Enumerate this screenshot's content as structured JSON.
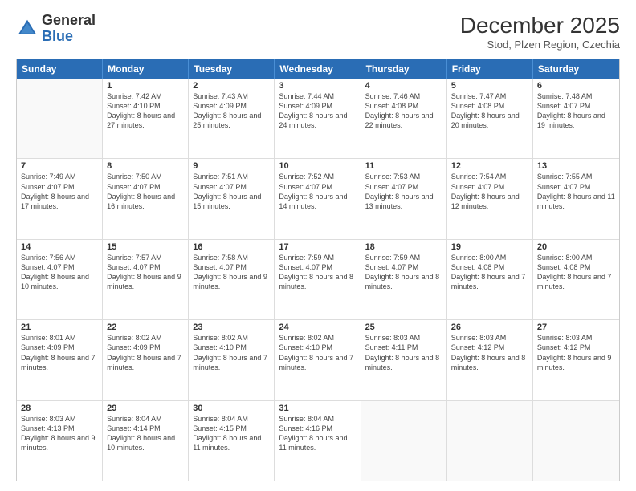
{
  "logo": {
    "text_general": "General",
    "text_blue": "Blue"
  },
  "title": "December 2025",
  "subtitle": "Stod, Plzen Region, Czechia",
  "days": [
    "Sunday",
    "Monday",
    "Tuesday",
    "Wednesday",
    "Thursday",
    "Friday",
    "Saturday"
  ],
  "weeks": [
    [
      {
        "day": "",
        "empty": true
      },
      {
        "day": "1",
        "sunrise": "7:42 AM",
        "sunset": "4:10 PM",
        "daylight": "8 hours and 27 minutes."
      },
      {
        "day": "2",
        "sunrise": "7:43 AM",
        "sunset": "4:09 PM",
        "daylight": "8 hours and 25 minutes."
      },
      {
        "day": "3",
        "sunrise": "7:44 AM",
        "sunset": "4:09 PM",
        "daylight": "8 hours and 24 minutes."
      },
      {
        "day": "4",
        "sunrise": "7:46 AM",
        "sunset": "4:08 PM",
        "daylight": "8 hours and 22 minutes."
      },
      {
        "day": "5",
        "sunrise": "7:47 AM",
        "sunset": "4:08 PM",
        "daylight": "8 hours and 20 minutes."
      },
      {
        "day": "6",
        "sunrise": "7:48 AM",
        "sunset": "4:07 PM",
        "daylight": "8 hours and 19 minutes."
      }
    ],
    [
      {
        "day": "7",
        "sunrise": "7:49 AM",
        "sunset": "4:07 PM",
        "daylight": "8 hours and 17 minutes."
      },
      {
        "day": "8",
        "sunrise": "7:50 AM",
        "sunset": "4:07 PM",
        "daylight": "8 hours and 16 minutes."
      },
      {
        "day": "9",
        "sunrise": "7:51 AM",
        "sunset": "4:07 PM",
        "daylight": "8 hours and 15 minutes."
      },
      {
        "day": "10",
        "sunrise": "7:52 AM",
        "sunset": "4:07 PM",
        "daylight": "8 hours and 14 minutes."
      },
      {
        "day": "11",
        "sunrise": "7:53 AM",
        "sunset": "4:07 PM",
        "daylight": "8 hours and 13 minutes."
      },
      {
        "day": "12",
        "sunrise": "7:54 AM",
        "sunset": "4:07 PM",
        "daylight": "8 hours and 12 minutes."
      },
      {
        "day": "13",
        "sunrise": "7:55 AM",
        "sunset": "4:07 PM",
        "daylight": "8 hours and 11 minutes."
      }
    ],
    [
      {
        "day": "14",
        "sunrise": "7:56 AM",
        "sunset": "4:07 PM",
        "daylight": "8 hours and 10 minutes."
      },
      {
        "day": "15",
        "sunrise": "7:57 AM",
        "sunset": "4:07 PM",
        "daylight": "8 hours and 9 minutes."
      },
      {
        "day": "16",
        "sunrise": "7:58 AM",
        "sunset": "4:07 PM",
        "daylight": "8 hours and 9 minutes."
      },
      {
        "day": "17",
        "sunrise": "7:59 AM",
        "sunset": "4:07 PM",
        "daylight": "8 hours and 8 minutes."
      },
      {
        "day": "18",
        "sunrise": "7:59 AM",
        "sunset": "4:07 PM",
        "daylight": "8 hours and 8 minutes."
      },
      {
        "day": "19",
        "sunrise": "8:00 AM",
        "sunset": "4:08 PM",
        "daylight": "8 hours and 7 minutes."
      },
      {
        "day": "20",
        "sunrise": "8:00 AM",
        "sunset": "4:08 PM",
        "daylight": "8 hours and 7 minutes."
      }
    ],
    [
      {
        "day": "21",
        "sunrise": "8:01 AM",
        "sunset": "4:09 PM",
        "daylight": "8 hours and 7 minutes."
      },
      {
        "day": "22",
        "sunrise": "8:02 AM",
        "sunset": "4:09 PM",
        "daylight": "8 hours and 7 minutes."
      },
      {
        "day": "23",
        "sunrise": "8:02 AM",
        "sunset": "4:10 PM",
        "daylight": "8 hours and 7 minutes."
      },
      {
        "day": "24",
        "sunrise": "8:02 AM",
        "sunset": "4:10 PM",
        "daylight": "8 hours and 7 minutes."
      },
      {
        "day": "25",
        "sunrise": "8:03 AM",
        "sunset": "4:11 PM",
        "daylight": "8 hours and 8 minutes."
      },
      {
        "day": "26",
        "sunrise": "8:03 AM",
        "sunset": "4:12 PM",
        "daylight": "8 hours and 8 minutes."
      },
      {
        "day": "27",
        "sunrise": "8:03 AM",
        "sunset": "4:12 PM",
        "daylight": "8 hours and 9 minutes."
      }
    ],
    [
      {
        "day": "28",
        "sunrise": "8:03 AM",
        "sunset": "4:13 PM",
        "daylight": "8 hours and 9 minutes."
      },
      {
        "day": "29",
        "sunrise": "8:04 AM",
        "sunset": "4:14 PM",
        "daylight": "8 hours and 10 minutes."
      },
      {
        "day": "30",
        "sunrise": "8:04 AM",
        "sunset": "4:15 PM",
        "daylight": "8 hours and 11 minutes."
      },
      {
        "day": "31",
        "sunrise": "8:04 AM",
        "sunset": "4:16 PM",
        "daylight": "8 hours and 11 minutes."
      },
      {
        "day": "",
        "empty": true
      },
      {
        "day": "",
        "empty": true
      },
      {
        "day": "",
        "empty": true
      }
    ]
  ]
}
